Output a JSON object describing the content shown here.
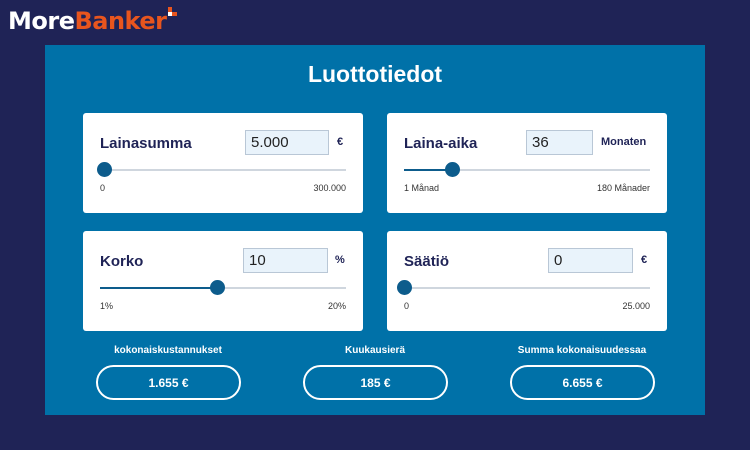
{
  "logo": {
    "part1": "More",
    "part2": "Banker"
  },
  "title": "Luottotiedot",
  "fields": {
    "amount": {
      "label": "Lainasumma",
      "value": "5.000",
      "unit": "€",
      "min_label": "0",
      "max_label": "300.000",
      "min": 0,
      "max": 300000,
      "current": 5000
    },
    "term": {
      "label": "Laina-aika",
      "value": "36",
      "unit": "Monaten",
      "min_label": "1 Månad",
      "max_label": "180 Månader",
      "min": 1,
      "max": 180,
      "current": 36
    },
    "interest": {
      "label": "Korko",
      "value": "10",
      "unit": "%",
      "min_label": "1%",
      "max_label": "20%",
      "min": 1,
      "max": 20,
      "current": 10
    },
    "savings": {
      "label": "Säätiö",
      "value": "0",
      "unit": "€",
      "min_label": "0",
      "max_label": "25.000",
      "min": 0,
      "max": 25000,
      "current": 0
    }
  },
  "summary": {
    "total_cost": {
      "label": "kokonaiskustannukset",
      "value": "1.655 €"
    },
    "monthly": {
      "label": "Kuukausierä",
      "value": "185 €"
    },
    "grand_total": {
      "label": "Summa kokonaisuudessaa",
      "value": "6.655 €"
    }
  },
  "colors": {
    "background": "#1f2356",
    "panel": "#0071a8",
    "accent": "#e8551e",
    "slider": "#0d5c8c"
  }
}
